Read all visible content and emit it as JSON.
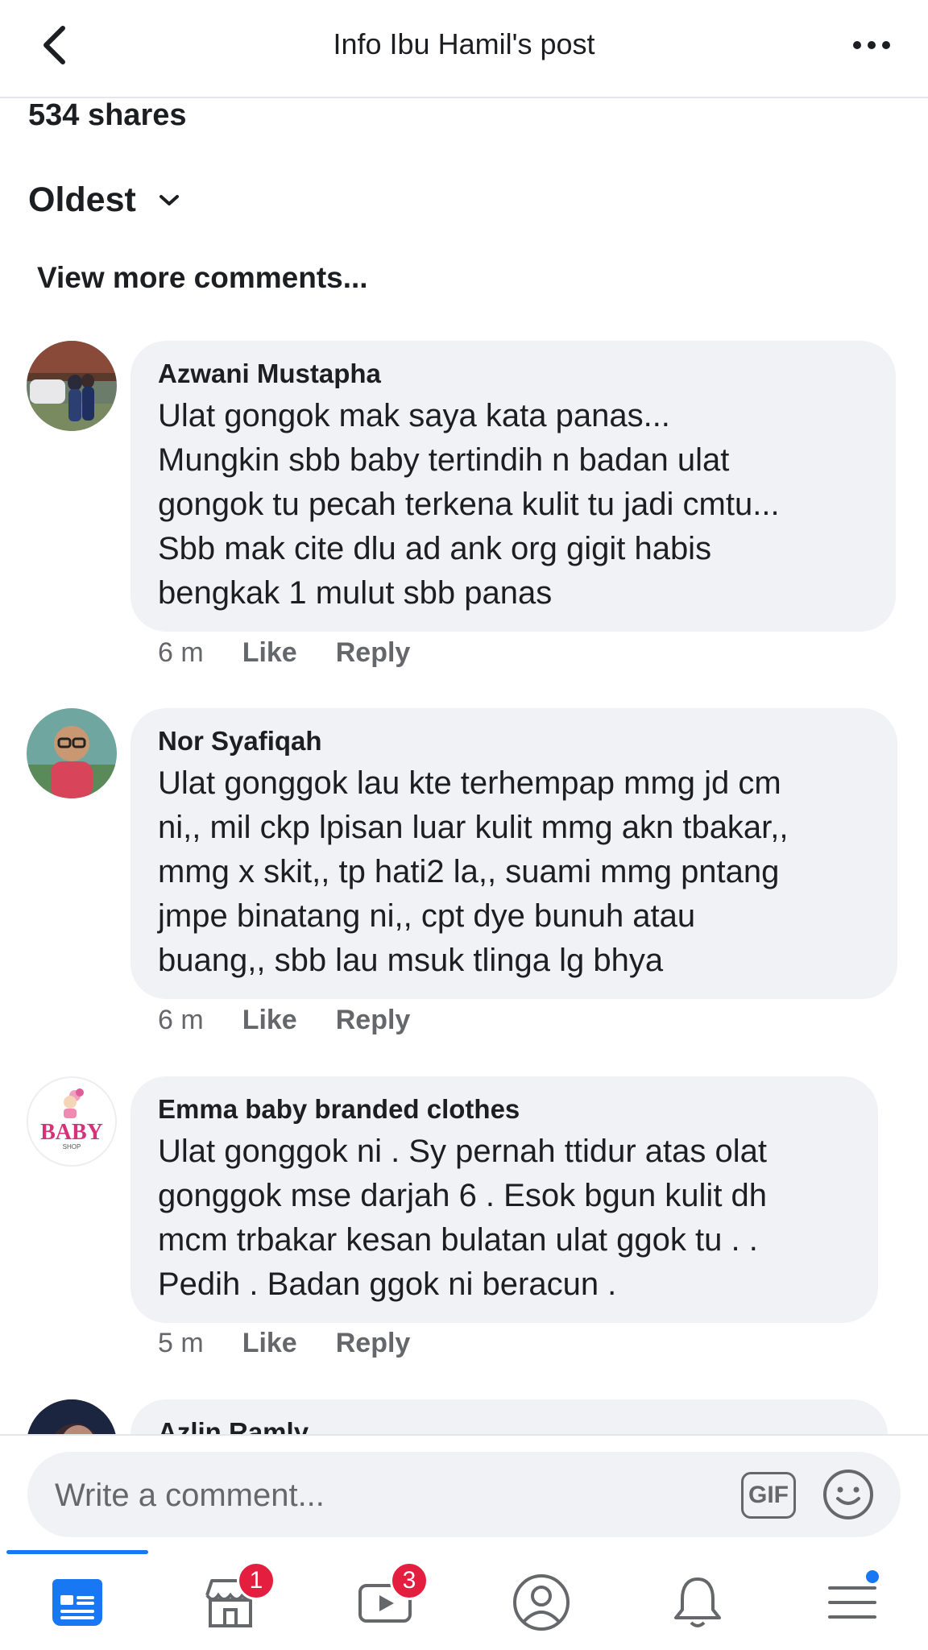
{
  "header": {
    "title": "Info Ibu Hamil's post"
  },
  "post": {
    "shares": "534 shares",
    "sort_label": "Oldest",
    "view_more": "View more comments..."
  },
  "comments": [
    {
      "author": "Azwani Mustapha",
      "text": "Ulat gongok mak saya kata panas...\nMungkin sbb baby tertindih n badan ulat\ngongok tu pecah terkena kulit tu jadi cmtu...\nSbb mak cite dlu ad ank org gigit habis\nbengkak 1 mulut sbb panas",
      "time": "6 m",
      "like": "Like",
      "reply": "Reply"
    },
    {
      "author": "Nor Syafiqah",
      "text": "Ulat gonggok lau kte terhempap mmg jd cm\nni,, mil ckp lpisan luar kulit mmg akn tbakar,,\nmmg x skit,, tp hati2 la,, suami mmg pntang\njmpe binatang ni,, cpt dye bunuh atau\nbuang,, sbb lau msuk tlinga lg bhya",
      "time": "6 m",
      "like": "Like",
      "reply": "Reply"
    },
    {
      "author": "Emma baby branded clothes",
      "text": "Ulat gonggok ni . Sy pernah ttidur atas olat\ngonggok mse darjah 6 . Esok bgun kulit dh\nmcm trbakar kesan bulatan ulat ggok tu . .\nPedih . Badan ggok ni beracun .",
      "time": "5 m",
      "like": "Like",
      "reply": "Reply",
      "avatar_text": "BABY",
      "avatar_subtext": "SHOP"
    },
    {
      "author": "Azlin Ramly"
    }
  ],
  "composer": {
    "placeholder": "Write a comment...",
    "gif_label": "GIF"
  },
  "tabbar": {
    "marketplace_badge": "1",
    "watch_badge": "3"
  },
  "colors": {
    "accent": "#1877f2",
    "badge": "#e41e3f",
    "bubble": "#f0f2f5",
    "muted": "#65676b"
  }
}
